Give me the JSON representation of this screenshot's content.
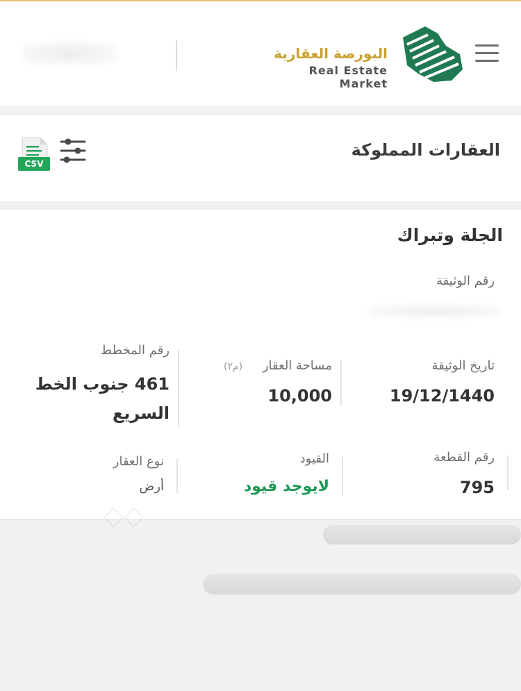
{
  "header": {
    "logo_ar": "البورصة العقارية",
    "logo_en": "Real Estate Market"
  },
  "owned_section": {
    "title": "العقارات المملوكة",
    "csv_label": "CSV"
  },
  "property": {
    "title": "الجلة وتبراك",
    "document_number_label": "رقم الوثيقة",
    "document_date_label": "تاريخ الوثيقة",
    "document_date": "19/12/1440",
    "area_label": "مساحة العقار",
    "area_unit": "(م٢)",
    "area_value": "10,000",
    "plan_number_label": "رقم المخطط",
    "plan_number_value": "461 جنوب الخط السريع",
    "parcel_number_label": "رقم القطعة",
    "parcel_number_value": "795",
    "restrictions_label": "القيود",
    "restrictions_value": "لايوجد قيود",
    "property_type_label": "نوع العقار",
    "property_type_value": "أرض"
  },
  "colors": {
    "brand_gold": "#c9a132",
    "brand_green": "#1f7a52",
    "status_green": "#1e9a56"
  }
}
